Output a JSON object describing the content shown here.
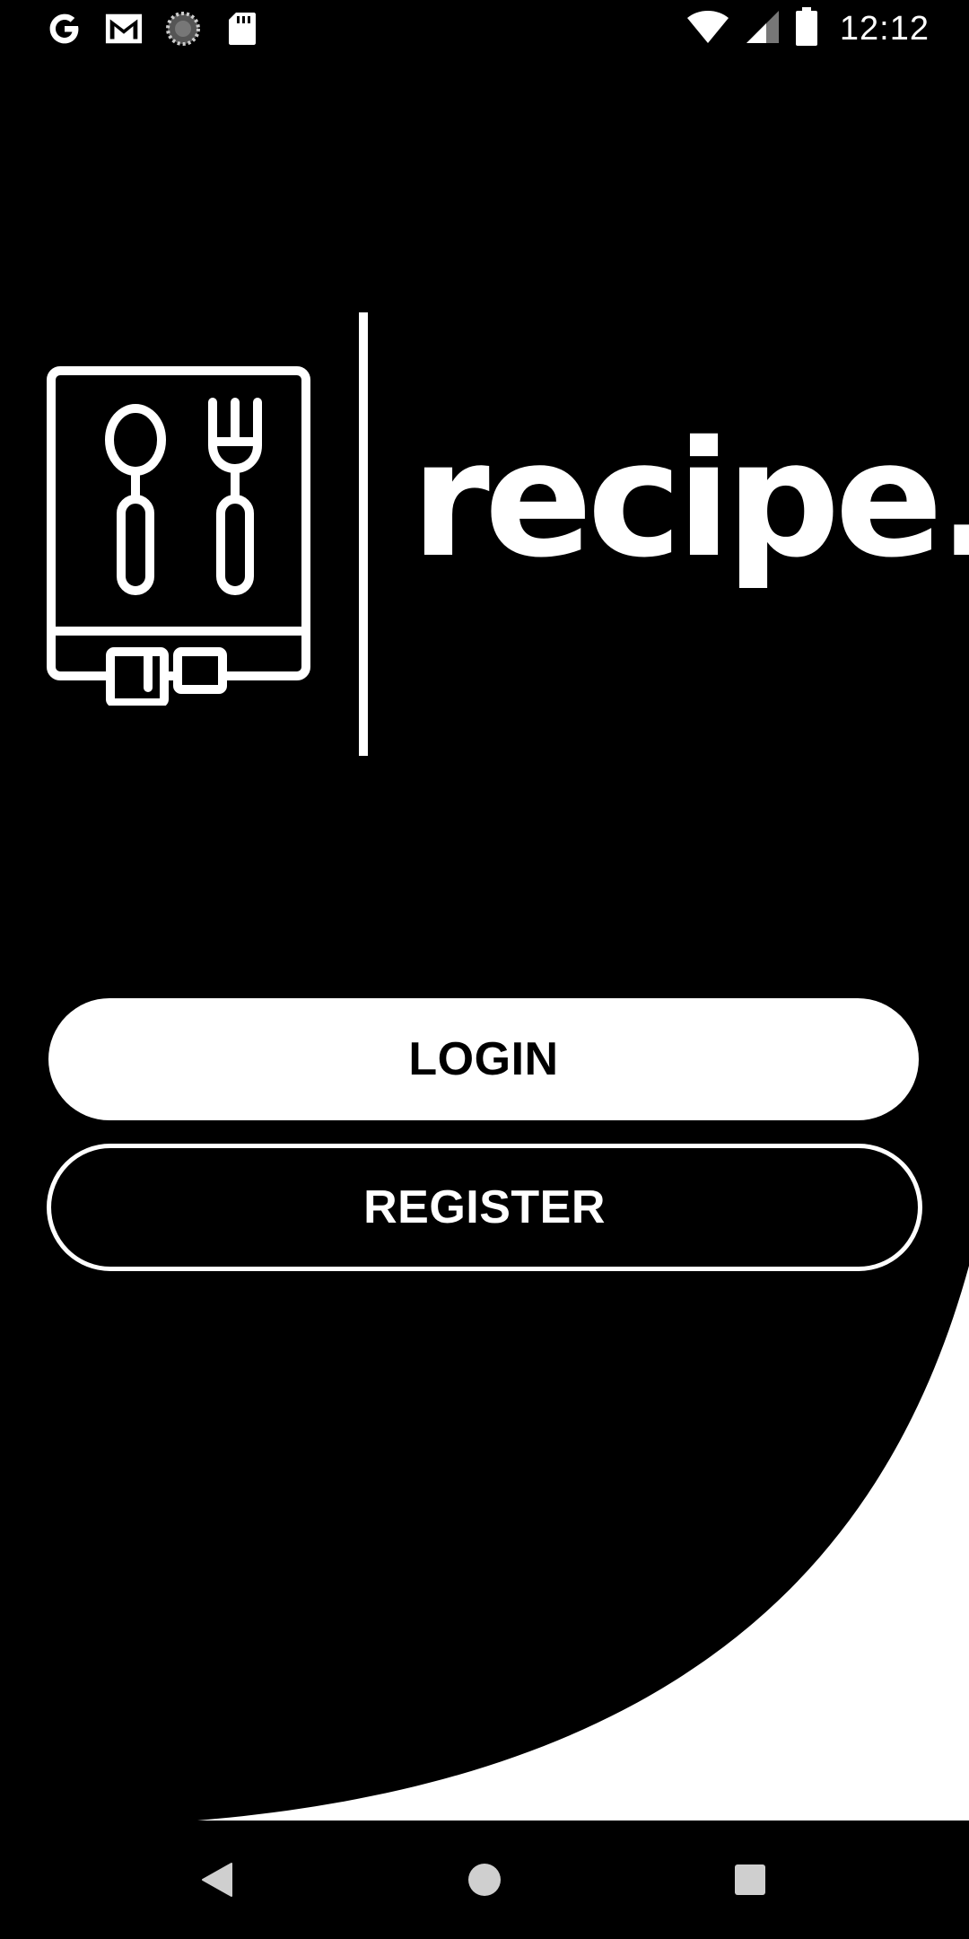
{
  "status_bar": {
    "time": "12:12",
    "left_icons": [
      "google-icon",
      "gmail-icon",
      "sync-icon",
      "sd-card-icon"
    ],
    "right_icons": [
      "wifi-icon",
      "signal-icon",
      "battery-icon"
    ]
  },
  "logo": {
    "wordmark": "recipe.",
    "icon": "recipe-book-icon"
  },
  "buttons": {
    "login_label": "LOGIN",
    "register_label": "REGISTER"
  },
  "nav_bar": {
    "items": [
      "back-icon",
      "home-icon",
      "recents-icon"
    ]
  },
  "colors": {
    "background": "#000000",
    "foreground": "#ffffff"
  }
}
